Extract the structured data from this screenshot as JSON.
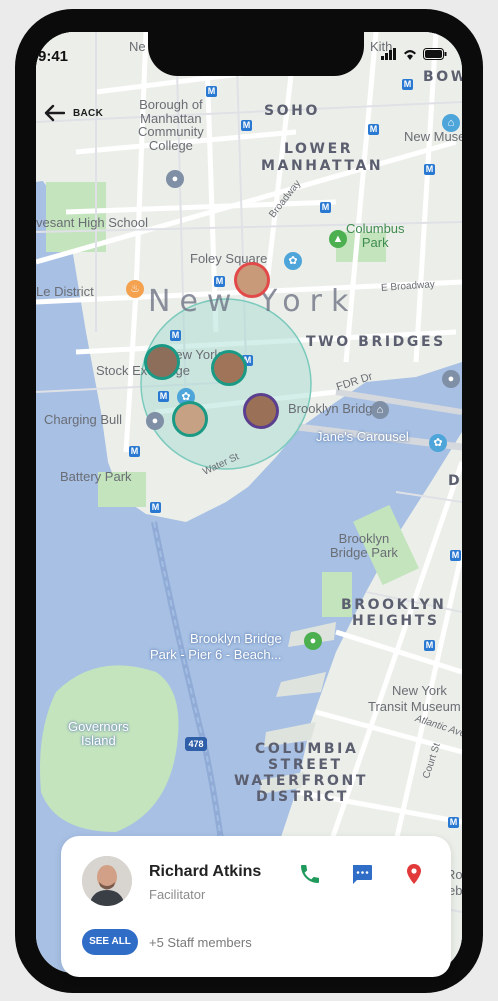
{
  "status_bar": {
    "time": "9:41"
  },
  "nav": {
    "back_label": "BACK"
  },
  "map_labels": {
    "soho": "SOHO",
    "lower_manhattan_1": "LOWER",
    "lower_manhattan_2": "MANHATTAN",
    "borough_of_1": "Borough of",
    "borough_of_2": "Manhattan",
    "borough_of_3": "Community",
    "borough_of_4": "College",
    "bowery": "BOWE",
    "new_museum": "New Muse",
    "stuyvesant": "vesant High School",
    "broadway": "Broadway",
    "columbus_park_1": "Columbus",
    "columbus_park_2": "Park",
    "foley_square": "Foley Square",
    "le_district": "Le District",
    "new_york": "New York",
    "e_broadway": "E Broadway",
    "two_bridges": "TWO BRIDGES",
    "ny_stock_1": "New York",
    "ny_stock_2": "Stock Exchange",
    "fdr_dr": "FDR Dr",
    "charging_bull": "Charging Bull",
    "brooklyn_bridge": "Brooklyn Bridge",
    "water_st": "Water St",
    "janes_carousel": "Jane's Carousel",
    "battery_park": "Battery Park",
    "brooklyn_bridge_park_1": "Brooklyn",
    "brooklyn_bridge_park_2": "Bridge Park",
    "brooklyn_heights_1": "BROOKLYN",
    "brooklyn_heights_2": "HEIGHTS",
    "pier6_1": "Brooklyn Bridge",
    "pier6_2": "Park - Pier 6 - Beach...",
    "transit_1": "New York",
    "transit_2": "Transit Museum",
    "atlantic_ave": "Atlantic Ave",
    "court_st": "Court St",
    "governors_1": "Governors",
    "governors_2": "Island",
    "highway_478": "478",
    "columbia_1": "COLUMBIA",
    "columbia_2": "STREET",
    "columbia_3": "WATERFRONT",
    "columbia_4": "DISTRICT",
    "kith": "Kith",
    "ne_fi": "Ne",
    "d_label": "D",
    "roy": "Roy",
    "rebo": "ebo"
  },
  "contact_card": {
    "name": "Richard Atkins",
    "role": "Facilitator",
    "see_all": "SEE ALL",
    "staff_text": "+5  Staff members"
  },
  "colors": {
    "water": "#a7c0e4",
    "land": "#ecefe9",
    "park": "#c4e4bd",
    "accent": "#2f6dc7",
    "team_circle": "#9fd9cf",
    "phone_icon": "#1f9a5b",
    "chat_icon": "#2f6dc7",
    "pin_icon": "#e23a3a"
  }
}
